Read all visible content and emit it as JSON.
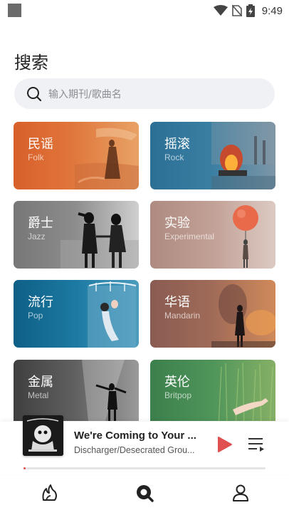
{
  "status_bar": {
    "time": "9:49"
  },
  "header": {
    "title": "搜索"
  },
  "search": {
    "placeholder": "输入期刊/歌曲名"
  },
  "categories": [
    {
      "title": "民谣",
      "subtitle": "Folk"
    },
    {
      "title": "摇滚",
      "subtitle": "Rock"
    },
    {
      "title": "爵士",
      "subtitle": "Jazz"
    },
    {
      "title": "实验",
      "subtitle": "Experimental"
    },
    {
      "title": "流行",
      "subtitle": "Pop"
    },
    {
      "title": "华语",
      "subtitle": "Mandarin"
    },
    {
      "title": "金属",
      "subtitle": "Metal"
    },
    {
      "title": "英伦",
      "subtitle": "Britpop"
    }
  ],
  "player": {
    "title": "We're Coming to Your ...",
    "artist": "Discharger/Desecrated Grou...",
    "progress": 0.01
  },
  "colors": {
    "accent": "#e05050",
    "search_bg": "#eff1f5"
  },
  "nav": {
    "items": [
      "discover-icon",
      "search-icon",
      "profile-icon"
    ],
    "active": "search-icon"
  }
}
